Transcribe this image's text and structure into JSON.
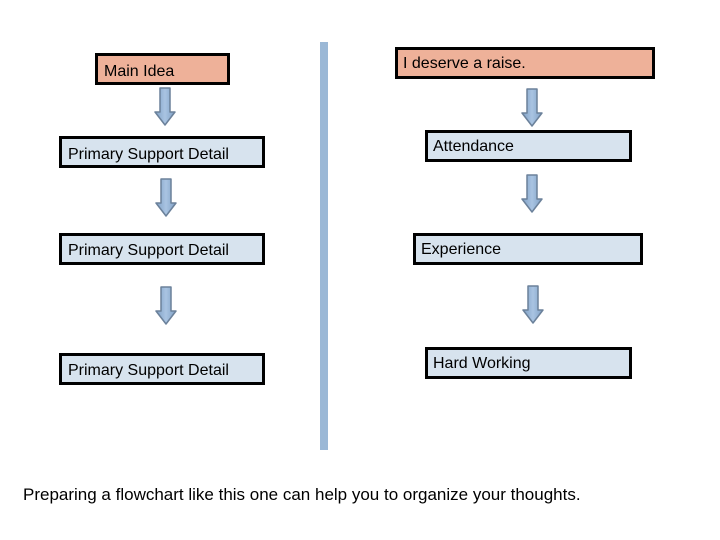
{
  "left_column": {
    "main": "Main Idea",
    "details": [
      "Primary Support Detail",
      "Primary Support Detail",
      "Primary Support Detail"
    ]
  },
  "right_column": {
    "main": "I deserve a raise.",
    "details": [
      "Attendance",
      "Experience",
      "Hard Working"
    ]
  },
  "caption": "Preparing a flowchart like this one can help you to organize your thoughts.",
  "colors": {
    "main_box_fill": "#eeb199",
    "detail_box_fill": "#d7e3ee",
    "arrow_fill": "#8fb0d2",
    "divider": "#9bb8d6"
  }
}
